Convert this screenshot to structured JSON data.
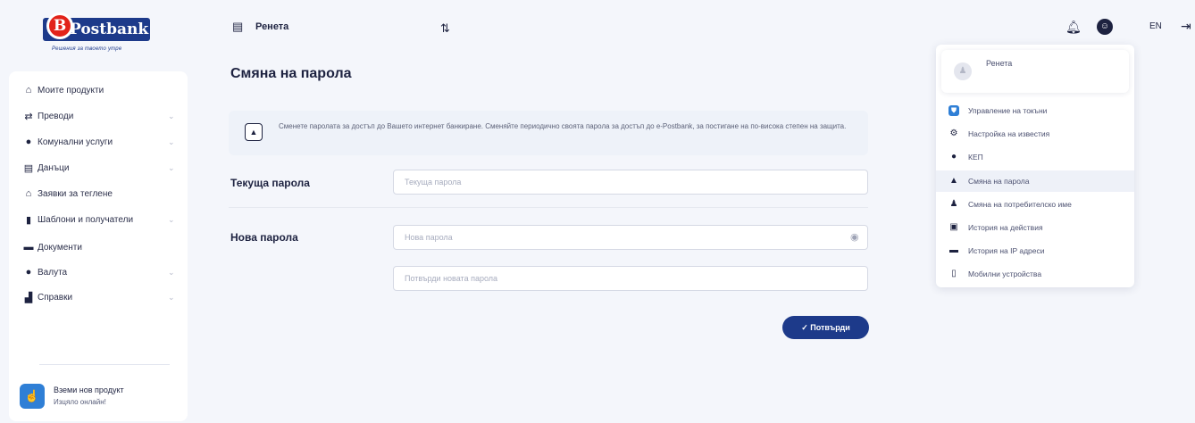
{
  "brand": {
    "name": "Postbank",
    "mark": "B",
    "tagline": "Решения за твоето утре"
  },
  "sidebar": {
    "items": [
      {
        "label": "Моите продукти",
        "icon": "home-icon",
        "glyph": "⌂",
        "chevron": false
      },
      {
        "label": "Преводи",
        "icon": "transfer-icon",
        "glyph": "⇄",
        "chevron": true
      },
      {
        "label": "Комунални услуги",
        "icon": "bulb-icon",
        "glyph": "●",
        "chevron": true
      },
      {
        "label": "Данъци",
        "icon": "tax-icon",
        "glyph": "▤",
        "chevron": true
      },
      {
        "label": "Заявки за теглене",
        "icon": "bank-icon",
        "glyph": "⌂",
        "chevron": false
      },
      {
        "label": "Шаблони и получатели",
        "icon": "template-icon",
        "glyph": "▮",
        "chevron": true
      },
      {
        "label": "Документи",
        "icon": "folder-icon",
        "glyph": "▬",
        "chevron": false
      },
      {
        "label": "Валута",
        "icon": "currency-icon",
        "glyph": "●",
        "chevron": true
      },
      {
        "label": "Справки",
        "icon": "reports-icon",
        "glyph": "▟",
        "chevron": true
      }
    ],
    "chevron_glyph": "⌄",
    "promo": {
      "title": "Вземи нов продукт",
      "subtitle": "Изцяло онлайн!"
    }
  },
  "topbar": {
    "user_name": "Ренета",
    "lang": "EN"
  },
  "main": {
    "title": "Смяна на парола",
    "info_text": "Сменете паролата за достъп до Вашето интернет банкиране. Сменяйте периодично своята парола за достъп до e-Postbank, за постигане на по-висока степен на защита.",
    "current_password": {
      "label": "Текуща парола",
      "placeholder": "Текуща парола",
      "value": ""
    },
    "new_password": {
      "label": "Нова парола",
      "placeholder": "Нова парола",
      "value": ""
    },
    "confirm_password": {
      "placeholder": "Потвърди новата парола",
      "value": ""
    },
    "confirm_button": "✓ Потвърди"
  },
  "dropdown": {
    "user_name": "Ренета",
    "items": [
      {
        "label": "Управление на токъни",
        "icon": "token-icon",
        "glyph": "⛊",
        "active": false,
        "blue": true
      },
      {
        "label": "Настройка на известия",
        "icon": "gear-icon",
        "glyph": "⚙",
        "active": false,
        "blue": false
      },
      {
        "label": "КЕП",
        "icon": "shield-check-icon",
        "glyph": "●",
        "active": false,
        "blue": false
      },
      {
        "label": "Смяна на парола",
        "icon": "lock-icon",
        "glyph": "▲",
        "active": true,
        "blue": false
      },
      {
        "label": "Смяна на потребителско име",
        "icon": "user-icon",
        "glyph": "♟",
        "active": false,
        "blue": false
      },
      {
        "label": "История на действия",
        "icon": "history-icon",
        "glyph": "▣",
        "active": false,
        "blue": false
      },
      {
        "label": "История на IP адреси",
        "icon": "monitor-icon",
        "glyph": "▬",
        "active": false,
        "blue": false
      },
      {
        "label": "Мобилни устройства",
        "icon": "phone-icon",
        "glyph": "▯",
        "active": false,
        "blue": false
      }
    ]
  },
  "colors": {
    "brand_navy": "#1d3a8a",
    "brand_red": "#e2231a",
    "accent_blue": "#2f7fd6",
    "text_dark": "#1d2240",
    "background": "#f4f6fb"
  }
}
